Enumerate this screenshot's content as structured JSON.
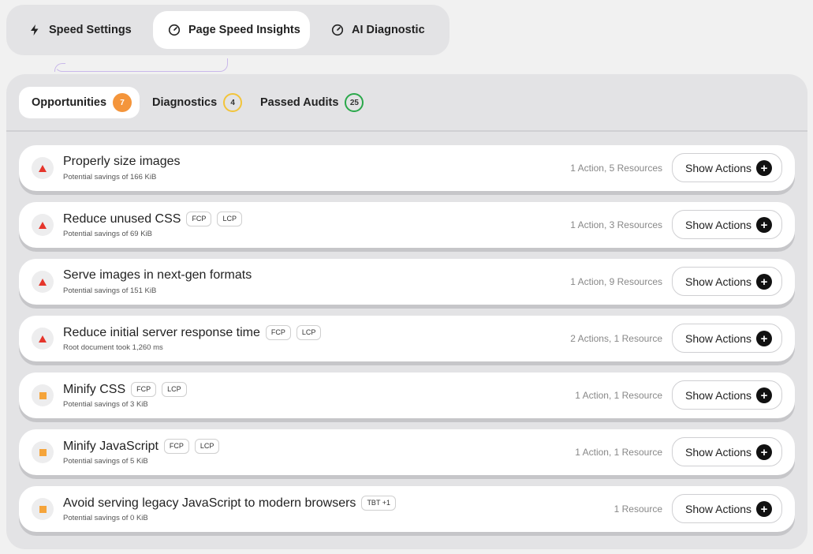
{
  "top_tabs": [
    {
      "label": "Speed Settings",
      "icon": "bolt-icon"
    },
    {
      "label": "Page Speed Insights",
      "icon": "gauge-icon",
      "active": true
    },
    {
      "label": "AI Diagnostic",
      "icon": "gauge-icon"
    }
  ],
  "sub_tabs": [
    {
      "label": "Opportunities",
      "count": "7",
      "color": "#f4953b",
      "active": true
    },
    {
      "label": "Diagnostics",
      "count": "4",
      "color": "#f2c43a"
    },
    {
      "label": "Passed Audits",
      "count": "25",
      "color": "#2aa84a"
    }
  ],
  "button_label": "Show Actions",
  "audits": [
    {
      "title": "Properly size images",
      "tags": [],
      "sub": "Potential savings of 166 KiB",
      "meta": "1 Action, 5 Resources",
      "severity": "high"
    },
    {
      "title": "Reduce unused CSS",
      "tags": [
        "FCP",
        "LCP"
      ],
      "sub": "Potential savings of 69 KiB",
      "meta": "1 Action, 3 Resources",
      "severity": "high"
    },
    {
      "title": "Serve images in next-gen formats",
      "tags": [],
      "sub": "Potential savings of 151 KiB",
      "meta": "1 Action, 9 Resources",
      "severity": "high"
    },
    {
      "title": "Reduce initial server response time",
      "tags": [
        "FCP",
        "LCP"
      ],
      "sub": "Root document took 1,260 ms",
      "meta": "2 Actions, 1 Resource",
      "severity": "high"
    },
    {
      "title": "Minify CSS",
      "tags": [
        "FCP",
        "LCP"
      ],
      "sub": "Potential savings of 3 KiB",
      "meta": "1 Action, 1 Resource",
      "severity": "medium"
    },
    {
      "title": "Minify JavaScript",
      "tags": [
        "FCP",
        "LCP"
      ],
      "sub": "Potential savings of 5 KiB",
      "meta": "1 Action, 1 Resource",
      "severity": "medium"
    },
    {
      "title": "Avoid serving legacy JavaScript to modern browsers",
      "tags": [
        "TBT +1"
      ],
      "sub": "Potential savings of 0 KiB",
      "meta": "1 Resource",
      "severity": "medium"
    }
  ]
}
